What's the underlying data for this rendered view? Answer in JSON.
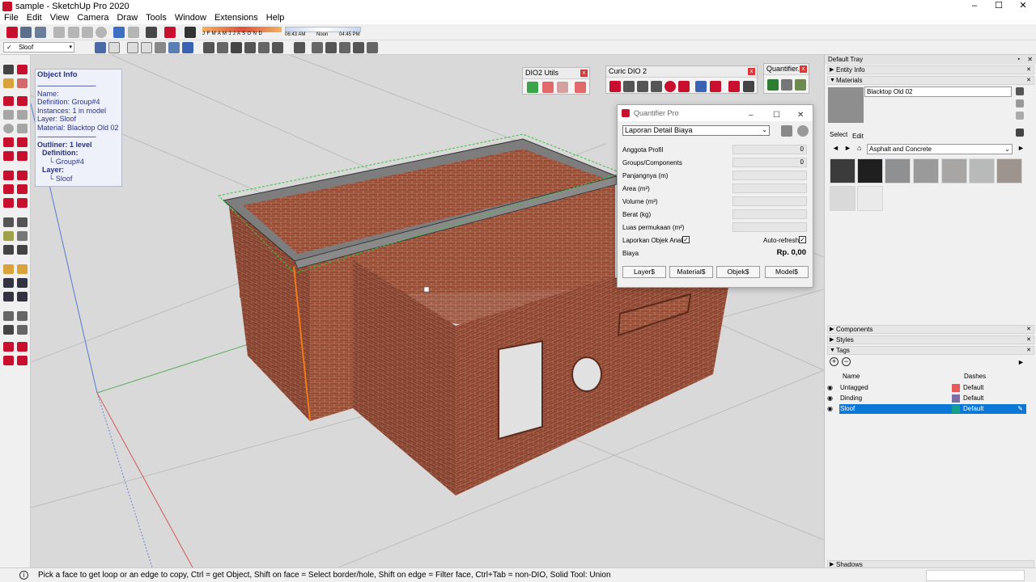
{
  "window": {
    "title": "sample - SketchUp Pro 2020",
    "min": "–",
    "max": "☐",
    "close": "✕"
  },
  "menu": [
    "File",
    "Edit",
    "View",
    "Camera",
    "Draw",
    "Tools",
    "Window",
    "Extensions",
    "Help"
  ],
  "shadow_months": "J F M A M J J A S O N D",
  "time_left": "06:43 AM",
  "time_mid": "Noon",
  "time_right": "04:45 PM",
  "tag_selector": "Sloof",
  "object_info": {
    "header": "Object Info",
    "rule": "------------------------------------",
    "name": "Name:",
    "definition": "Definition: Group#4",
    "instances": "Instances: 1 in model",
    "layer": "Layer: Sloof",
    "material": "Material: Blacktop Old 02",
    "outliner": "Outliner: 1 level",
    "def_label": "Definition:",
    "def_value": "└ Group#4",
    "layer_label": "Layer:",
    "layer_value": "└ Sloof"
  },
  "dio2_utils": {
    "title": "DIO2 Utils",
    "close": "x"
  },
  "curic_dio2": {
    "title": "Curic DIO 2",
    "close": "x"
  },
  "quantifier_bar": {
    "title": "Quantifier...",
    "close": "x"
  },
  "quantifier": {
    "title": "Quantifier Pro",
    "report": "Laporan Detail Biaya",
    "rows": [
      {
        "label": "Anggota Profil",
        "value": "0"
      },
      {
        "label": "Groups/Components",
        "value": "0"
      },
      {
        "label": "Panjangnya (m)",
        "value": ""
      },
      {
        "label": "Area (m²)",
        "value": ""
      },
      {
        "label": "Volume (m³)",
        "value": ""
      },
      {
        "label": "Berat (kg)",
        "value": ""
      },
      {
        "label": "Luas permukaan (m²)",
        "value": ""
      }
    ],
    "child_report": "Laporkan Objek Anak",
    "auto_refresh": "Auto-refresh",
    "cost_label": "Biaya",
    "cost_value": "Rp.  0,00",
    "buttons": [
      "Layer$",
      "Material$",
      "Objek$",
      "Model$"
    ]
  },
  "tray": {
    "title": "Default Tray",
    "entity_info": "Entity Info",
    "materials": "Materials",
    "material_name": "Blacktop Old 02",
    "tab_select": "Select",
    "tab_edit": "Edit",
    "library": "Asphalt and Concrete",
    "components": "Components",
    "styles": "Styles",
    "tags": "Tags",
    "col_name": "Name",
    "col_dashes": "Dashes",
    "shadows": "Shadows",
    "tag_rows": [
      {
        "name": "Untagged",
        "dash": "Default",
        "color": "#e85a5a"
      },
      {
        "name": "Dinding",
        "dash": "Default",
        "color": "#7b6fa6"
      },
      {
        "name": "Sloof",
        "dash": "Default",
        "color": "#14a08a"
      }
    ]
  },
  "status": {
    "message": "Pick a face to get loop or an edge to copy, Ctrl = get Object, Shift on face = Select border/hole, Shift on edge = Filter face, Ctrl+Tab = non-DIO, Solid Tool: Union"
  },
  "colors": {
    "brick": "#9a4a32",
    "selected_tag_bg": "#0b78d7",
    "sketchup_red": "#c8102e"
  }
}
